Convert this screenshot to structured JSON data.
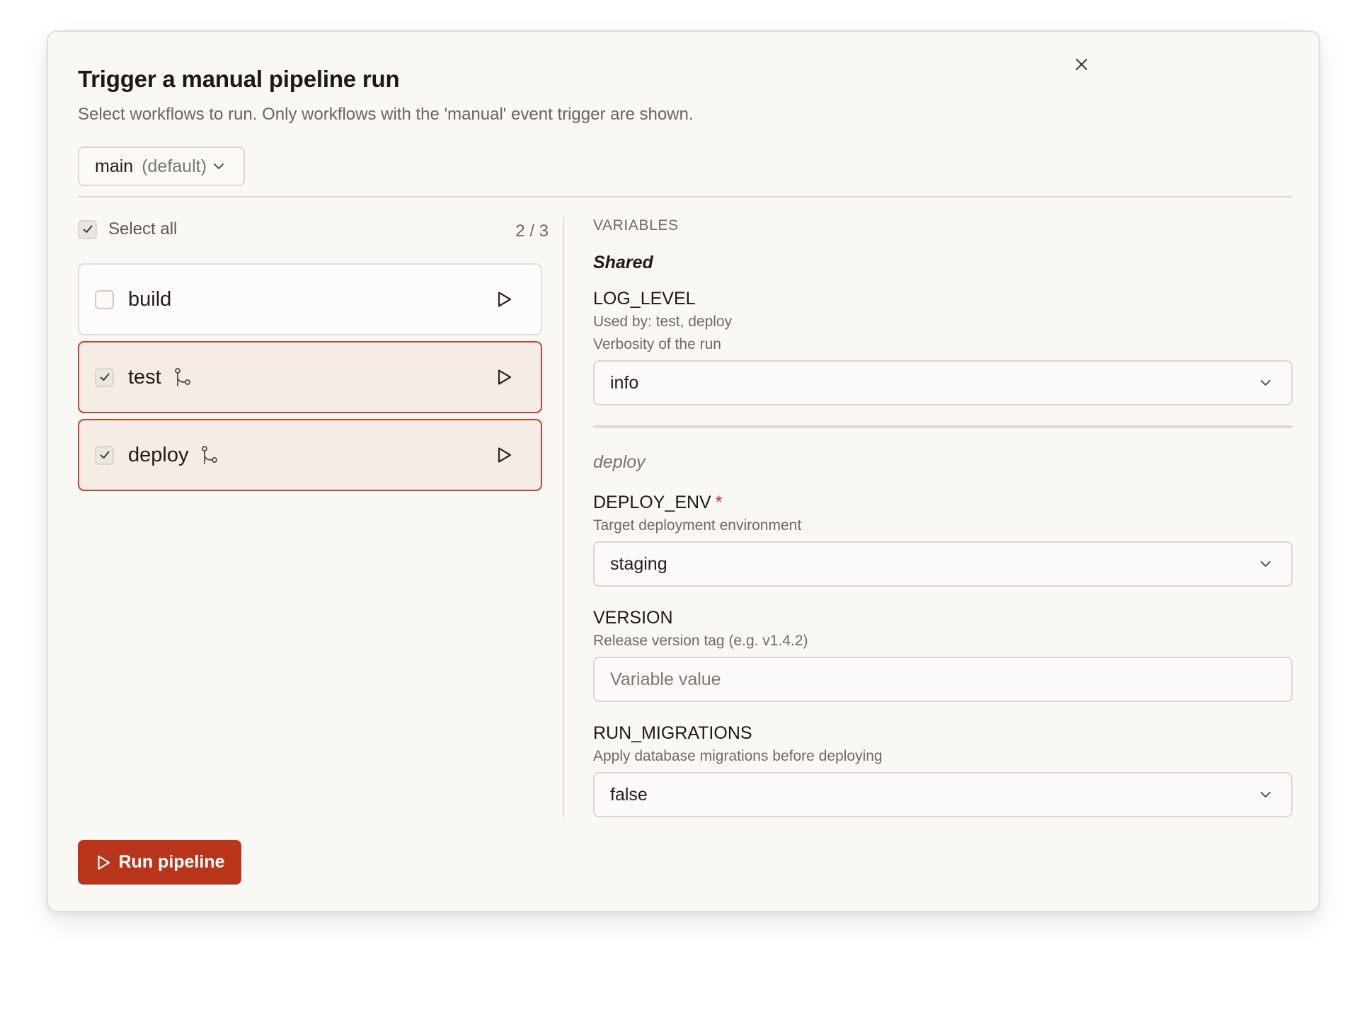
{
  "dialog": {
    "title": "Trigger a manual pipeline run",
    "subtitle": "Select workflows to run. Only workflows with the 'manual' event trigger are shown."
  },
  "branch": {
    "name": "main",
    "tag": "(default)"
  },
  "selection": {
    "select_all_label": "Select all",
    "count": "2 / 3"
  },
  "workflows": [
    {
      "name": "build",
      "checked": false,
      "branch_icon": false
    },
    {
      "name": "test",
      "checked": true,
      "branch_icon": true
    },
    {
      "name": "deploy",
      "checked": true,
      "branch_icon": true
    }
  ],
  "variables": {
    "heading": "VARIABLES",
    "shared": {
      "label": "Shared",
      "log_level": {
        "name": "LOG_LEVEL",
        "used_by": "Used by: test, deploy",
        "description": "Verbosity of the run",
        "value": "info"
      }
    },
    "deploy": {
      "label": "deploy",
      "deploy_env": {
        "name": "DEPLOY_ENV",
        "required_mark": "*",
        "description": "Target deployment environment",
        "value": "staging"
      },
      "version": {
        "name": "VERSION",
        "description": "Release version tag (e.g. v1.4.2)",
        "placeholder": "Variable value"
      },
      "run_migrations": {
        "name": "RUN_MIGRATIONS",
        "description": "Apply database migrations before deploying",
        "value": "false"
      }
    }
  },
  "actions": {
    "run_label": "Run pipeline"
  },
  "colors": {
    "accent": "#b8351b",
    "selected_bg": "#f6ece6",
    "required": "#c8322b"
  },
  "icons": [
    "close-icon",
    "chevron-down-icon",
    "check-icon",
    "git-branch-icon",
    "play-icon"
  ]
}
